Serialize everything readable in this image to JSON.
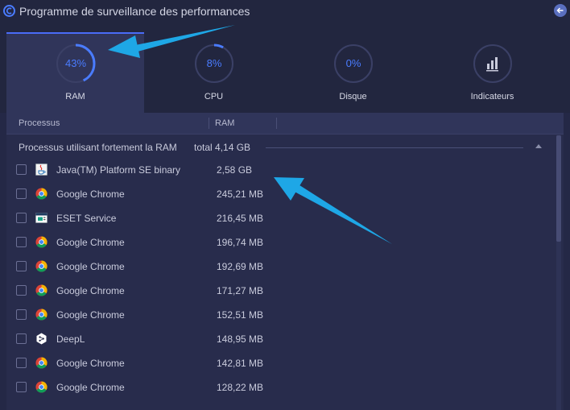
{
  "window": {
    "title": "Programme de surveillance des performances"
  },
  "tabs": [
    {
      "id": "ram",
      "label": "RAM",
      "value": "43%",
      "percent": 43,
      "active": true
    },
    {
      "id": "cpu",
      "label": "CPU",
      "value": "8%",
      "percent": 8,
      "active": false
    },
    {
      "id": "disk",
      "label": "Disque",
      "value": "0%",
      "percent": 0,
      "active": false
    },
    {
      "id": "indicators",
      "label": "Indicateurs",
      "value": "",
      "active": false
    }
  ],
  "table": {
    "columns": [
      "Processus",
      "RAM"
    ],
    "group": {
      "label": "Processus utilisant fortement la RAM",
      "total": "total 4,14 GB"
    },
    "rows": [
      {
        "name": "Java(TM) Platform SE binary",
        "ram": "2,58 GB",
        "icon": "java-icon"
      },
      {
        "name": "Google Chrome",
        "ram": "245,21 MB",
        "icon": "chrome-icon"
      },
      {
        "name": "ESET Service",
        "ram": "216,45 MB",
        "icon": "eset-icon"
      },
      {
        "name": "Google Chrome",
        "ram": "196,74 MB",
        "icon": "chrome-icon"
      },
      {
        "name": "Google Chrome",
        "ram": "192,69 MB",
        "icon": "chrome-icon"
      },
      {
        "name": "Google Chrome",
        "ram": "171,27 MB",
        "icon": "chrome-icon"
      },
      {
        "name": "Google Chrome",
        "ram": "152,51 MB",
        "icon": "chrome-icon"
      },
      {
        "name": "DeepL",
        "ram": "148,95 MB",
        "icon": "deepl-icon"
      },
      {
        "name": "Google Chrome",
        "ram": "142,81 MB",
        "icon": "chrome-icon"
      },
      {
        "name": "Google Chrome",
        "ram": "128,22 MB",
        "icon": "chrome-icon"
      }
    ]
  },
  "colors": {
    "accent": "#4a7cff",
    "annotation_arrow": "#1ea7e6"
  }
}
